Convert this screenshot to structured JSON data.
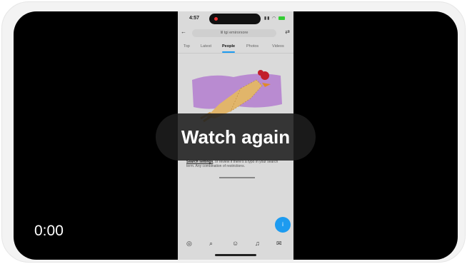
{
  "player": {
    "overlay_button": "Watch again",
    "timecode": "0:00"
  },
  "phone": {
    "status_time": "4:57",
    "search_query": "lil tgi emirorxore",
    "tabs": [
      "Top",
      "Latest",
      "People",
      "Photos",
      "Videos"
    ],
    "active_tab": "People",
    "description_link": "Search settings",
    "description_text": ", or review if there's a typo in your search term. Any combination of restrictions.",
    "fab_label": "i"
  },
  "colors": {
    "accent": "#1d9bf0",
    "art_background": "#b98bd1"
  }
}
